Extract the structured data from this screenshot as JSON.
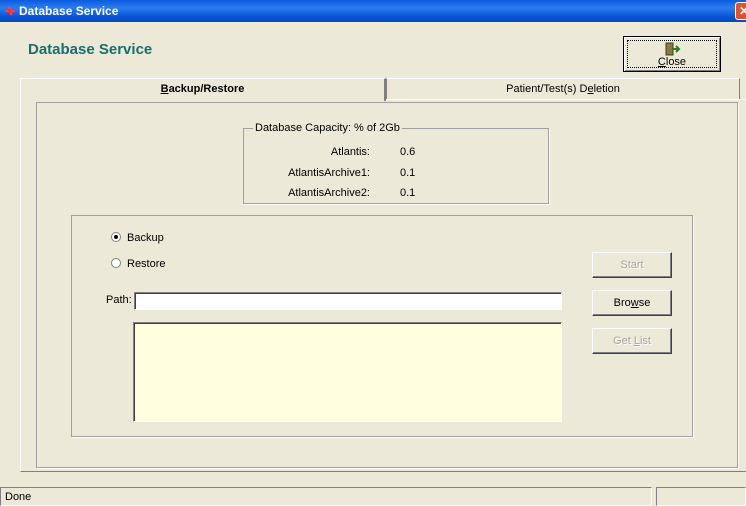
{
  "window": {
    "title": "Database Service",
    "close_glyph": "✕"
  },
  "header": {
    "title": "Database Service",
    "close_button": {
      "pre": "",
      "accel": "C",
      "post": "lose",
      "icon": "exit-door-icon"
    }
  },
  "tabs": [
    {
      "pre": "",
      "accel": "B",
      "post": "ackup/Restore",
      "selected": true
    },
    {
      "pre": "Patient/Test(s) D",
      "accel": "e",
      "post": "letion",
      "selected": false
    }
  ],
  "capacity": {
    "legend": "Database Capacity:  % of 2Gb",
    "rows": [
      {
        "label": "Atlantis:",
        "value": "0.6"
      },
      {
        "label": "AtlantisArchive1:",
        "value": "0.1"
      },
      {
        "label": "AtlantisArchive2:",
        "value": "0.1"
      }
    ]
  },
  "operation": {
    "options": [
      {
        "label": "Backup",
        "checked": true
      },
      {
        "label": "Restore",
        "checked": false
      }
    ]
  },
  "buttons": {
    "start": {
      "label": "Start",
      "enabled": false
    },
    "browse": {
      "pre": "Bro",
      "accel": "w",
      "post": "se",
      "enabled": true
    },
    "get_list": {
      "pre": "Get ",
      "accel": "L",
      "post": "ist",
      "enabled": false
    }
  },
  "path": {
    "label": "Path:",
    "value": ""
  },
  "status": {
    "text": "Done"
  },
  "colors": {
    "title_bar": "#0a5ce0",
    "header_text": "#1a6e6e",
    "list_background": "#ffffe0",
    "window": "#ece9d8"
  }
}
